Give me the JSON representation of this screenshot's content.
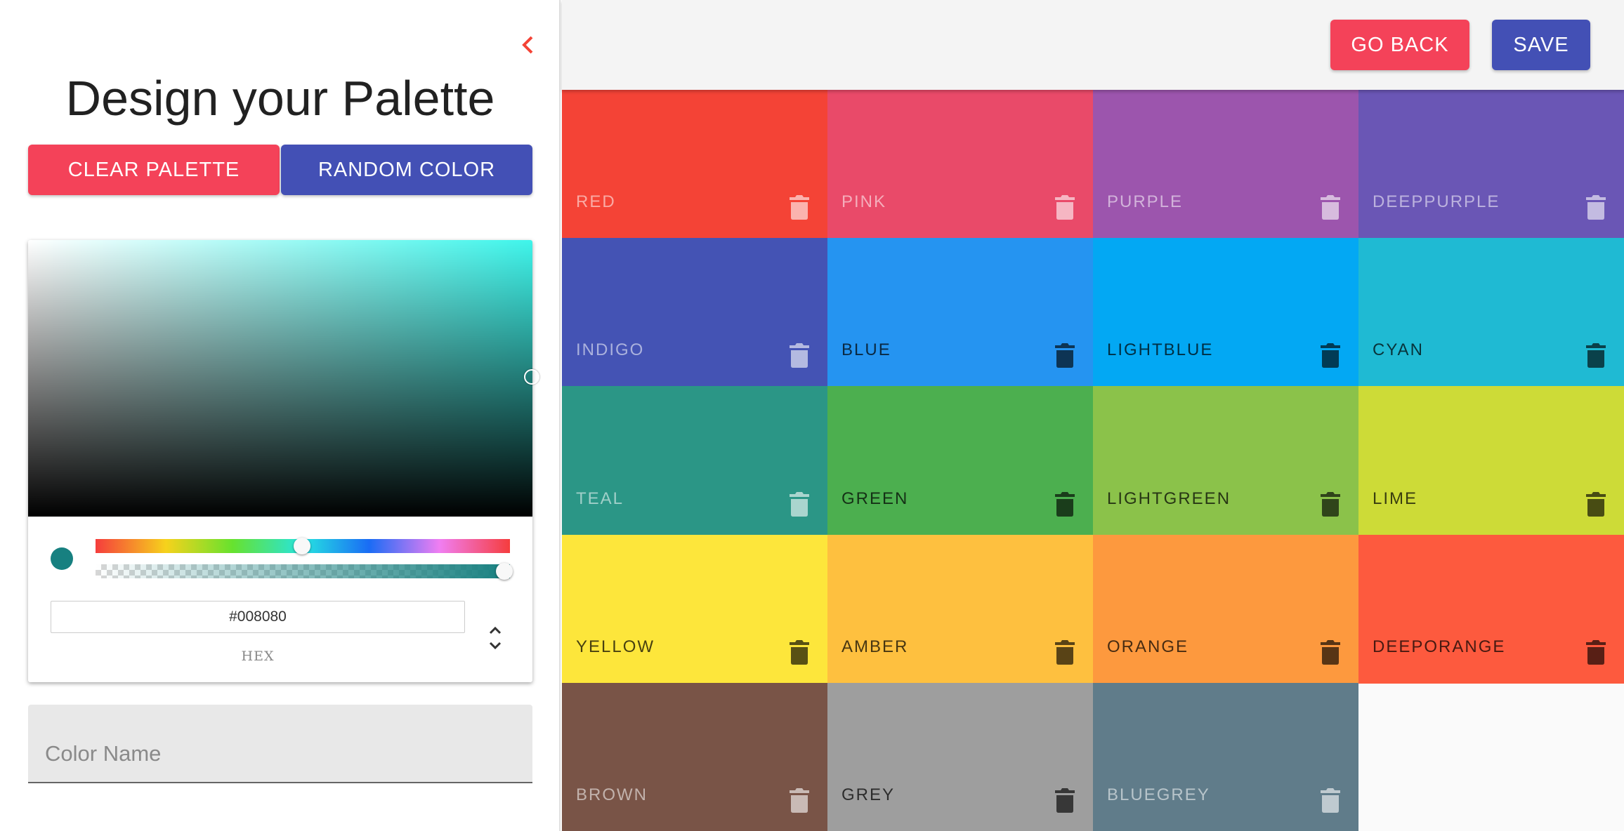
{
  "sidebar": {
    "title": "Design your Palette",
    "back_icon": "chevron-left-icon",
    "clear_label": "CLEAR PALETTE",
    "random_label": "RANDOM COLOR",
    "picker": {
      "hex_value": "#008080",
      "format_label": "HEX",
      "hue": 180,
      "alpha": 1,
      "preview_color": "#178080"
    },
    "color_name_placeholder": "Color Name"
  },
  "topbar": {
    "goback_label": "GO BACK",
    "save_label": "SAVE"
  },
  "colors": {
    "accent_red": "#f44259",
    "accent_indigo": "#4350b5"
  },
  "palette": [
    {
      "name": "RED",
      "color": "#f44336",
      "text": "light"
    },
    {
      "name": "PINK",
      "color": "#e94a69",
      "text": "light"
    },
    {
      "name": "PURPLE",
      "color": "#9c55ad",
      "text": "light"
    },
    {
      "name": "DEEPPURPLE",
      "color": "#6a56b5",
      "text": "light"
    },
    {
      "name": "INDIGO",
      "color": "#4453b4",
      "text": "light"
    },
    {
      "name": "BLUE",
      "color": "#2594f1",
      "text": "dark"
    },
    {
      "name": "LIGHTBLUE",
      "color": "#03a8f3",
      "text": "dark"
    },
    {
      "name": "CYAN",
      "color": "#1fbad3",
      "text": "dark"
    },
    {
      "name": "TEAL",
      "color": "#2b9686",
      "text": "light"
    },
    {
      "name": "GREEN",
      "color": "#4caf4f",
      "text": "dark"
    },
    {
      "name": "LIGHTGREEN",
      "color": "#8bc24a",
      "text": "dark"
    },
    {
      "name": "LIME",
      "color": "#cddb37",
      "text": "dark"
    },
    {
      "name": "YELLOW",
      "color": "#fde63b",
      "text": "dark"
    },
    {
      "name": "AMBER",
      "color": "#fec03f",
      "text": "dark"
    },
    {
      "name": "ORANGE",
      "color": "#fd993e",
      "text": "dark"
    },
    {
      "name": "DEEPORANGE",
      "color": "#fd5a3e",
      "text": "dark"
    },
    {
      "name": "BROWN",
      "color": "#795447",
      "text": "light"
    },
    {
      "name": "GREY",
      "color": "#9e9e9e",
      "text": "dark"
    },
    {
      "name": "BLUEGREY",
      "color": "#607c8a",
      "text": "light"
    }
  ]
}
